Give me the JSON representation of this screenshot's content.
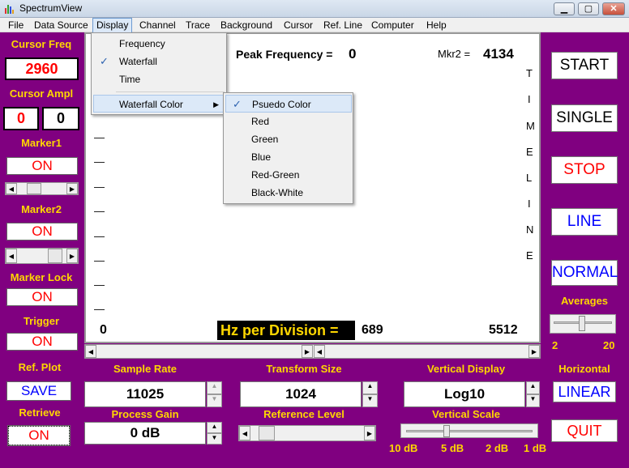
{
  "window": {
    "title": "SpectrumView"
  },
  "menubar": [
    "File",
    "Data Source",
    "Display",
    "Channel",
    "Trace",
    "Background",
    "Cursor",
    "Ref. Line",
    "Computer",
    "Help"
  ],
  "display_menu": {
    "items": [
      {
        "label": "Frequency",
        "checked": false
      },
      {
        "label": "Waterfall",
        "checked": true
      },
      {
        "label": "Time",
        "checked": false
      }
    ],
    "submenu_parent": "Waterfall Color"
  },
  "waterfall_color_menu": {
    "items": [
      {
        "label": "Psuedo Color",
        "checked": true
      },
      {
        "label": "Red",
        "checked": false
      },
      {
        "label": "Green",
        "checked": false
      },
      {
        "label": "Blue",
        "checked": false
      },
      {
        "label": "Red-Green",
        "checked": false
      },
      {
        "label": "Black-White",
        "checked": false
      }
    ]
  },
  "left": {
    "cursor_freq_label": "Cursor Freq",
    "cursor_freq_value": "2960",
    "cursor_ampl_label": "Cursor Ampl",
    "cursor_ampl_values": [
      "0",
      "0"
    ],
    "marker1_label": "Marker1",
    "marker1_state": "ON",
    "marker1_slider": 0.3,
    "marker2_label": "Marker2",
    "marker2_state": "ON",
    "marker2_slider": 0.6,
    "marker_lock_label": "Marker Lock",
    "marker_lock_state": "ON",
    "trigger_label": "Trigger",
    "trigger_state": "ON",
    "ref_plot_label": "Ref. Plot",
    "save_label": "SAVE",
    "retrieve_label": "Retrieve",
    "retrieve_state": "ON"
  },
  "plot": {
    "peak_label": "Peak Frequency =",
    "peak_value": "0",
    "mkr2_label": "Mkr2 =",
    "mkr2_value": "4134",
    "timeline_letters": [
      "T",
      "I",
      "M",
      "E",
      "L",
      "I",
      "N",
      "E"
    ],
    "x_min": "0",
    "x_max": "5512",
    "hz_per_div_label": "Hz per Division =",
    "hz_per_div_value": "689"
  },
  "right": {
    "start": "START",
    "single": "SINGLE",
    "stop": "STOP",
    "line": "LINE",
    "normal": "NORMAL",
    "averages_label": "Averages",
    "averages_min": "2",
    "averages_max": "20",
    "horizontal_label": "Horizontal",
    "horizontal_value": "LINEAR",
    "quit": "QUIT"
  },
  "bottom": {
    "sample_rate_label": "Sample Rate",
    "sample_rate_value": "11025",
    "transform_size_label": "Transform Size",
    "transform_size_value": "1024",
    "vertical_display_label": "Vertical Display",
    "vertical_display_value": "Log10",
    "process_gain_label": "Process Gain",
    "process_gain_value": "0 dB",
    "reference_level_label": "Reference Level",
    "vertical_scale_label": "Vertical Scale",
    "vertical_scale_ticks": [
      "10 dB",
      "5 dB",
      "2 dB",
      "1 dB"
    ]
  },
  "colors": {
    "background": "#800080",
    "label_yellow": "#ffd700",
    "red_text": "#ff0000",
    "blue_text": "#0000ff",
    "hz_box": "#000000"
  }
}
